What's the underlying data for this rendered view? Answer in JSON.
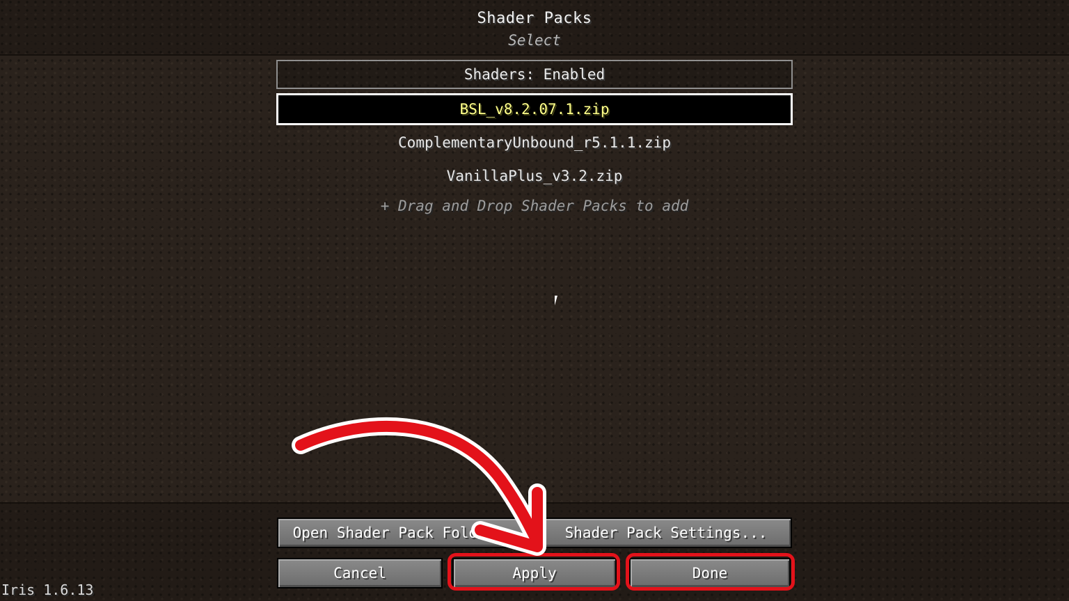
{
  "header": {
    "title": "Shader Packs",
    "subtitle": "Select"
  },
  "toggle": {
    "label": "Shaders: Enabled"
  },
  "packs": [
    {
      "name": "BSL_v8.2.07.1.zip",
      "selected": true
    },
    {
      "name": "ComplementaryUnbound_r5.1.1.zip",
      "selected": false
    },
    {
      "name": "VanillaPlus_v3.2.zip",
      "selected": false
    }
  ],
  "hint": "+ Drag and Drop Shader Packs to add",
  "buttons": {
    "open_folder": "Open Shader Pack Folder...",
    "settings": "Shader Pack Settings...",
    "cancel": "Cancel",
    "apply": "Apply",
    "done": "Done"
  },
  "version": "Iris 1.6.13",
  "colors": {
    "background": "#2a221c",
    "selected_text": "#ffff8a",
    "highlight_red": "#e3121a"
  },
  "icons": {
    "cursor": "mouse-pointer-icon",
    "annotation": "red-curved-arrow-icon"
  }
}
